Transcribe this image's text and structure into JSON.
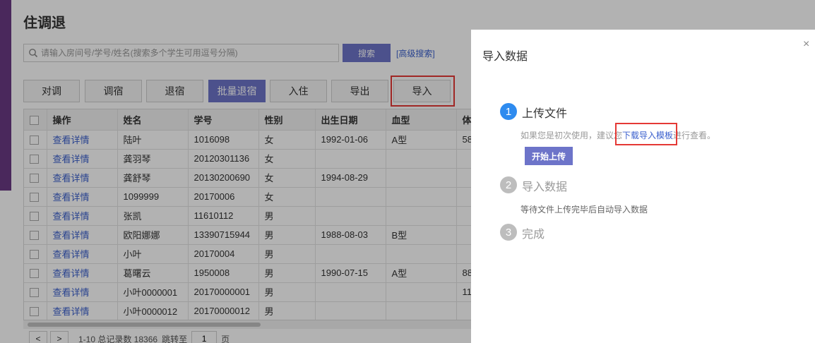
{
  "page": {
    "title": "住调退"
  },
  "search": {
    "placeholder": "请输入房间号/学号/姓名(搜索多个学生可用逗号分隔)",
    "button": "搜索",
    "advanced": "[高级搜索]"
  },
  "toolbar": {
    "buttons": [
      "对调",
      "调宿",
      "退宿",
      "批量退宿",
      "入住",
      "导出",
      "导入"
    ]
  },
  "table": {
    "columns": [
      "操作",
      "姓名",
      "学号",
      "性别",
      "出生日期",
      "血型",
      "体"
    ],
    "rows": [
      [
        "查看详情",
        "陆叶",
        "1016098",
        "女",
        "1992-01-06",
        "A型",
        "58"
      ],
      [
        "查看详情",
        "龚羽琴",
        "20120301136",
        "女",
        "",
        "",
        ""
      ],
      [
        "查看详情",
        "龚舒琴",
        "20130200690",
        "女",
        "1994-08-29",
        "",
        ""
      ],
      [
        "查看详情",
        "1099999",
        "20170006",
        "女",
        "",
        "",
        ""
      ],
      [
        "查看详情",
        "张凯",
        "11610112",
        "男",
        "",
        "",
        ""
      ],
      [
        "查看详情",
        "欧阳娜娜",
        "13390715944",
        "男",
        "1988-08-03",
        "B型",
        ""
      ],
      [
        "查看详情",
        "小叶",
        "20170004",
        "男",
        "",
        "",
        ""
      ],
      [
        "查看详情",
        "葛曙云",
        "1950008",
        "男",
        "1990-07-15",
        "A型",
        "88"
      ],
      [
        "查看详情",
        "小叶0000001",
        "20170000001",
        "男",
        "",
        "",
        "11"
      ],
      [
        "查看详情",
        "小叶0000012",
        "20170000012",
        "男",
        "",
        "",
        ""
      ]
    ]
  },
  "pager": {
    "prev": "<",
    "next": ">",
    "summary": "1-10 总记录数 18366",
    "jump_label": "跳转至",
    "page": "1",
    "page_unit": "页"
  },
  "dialog": {
    "title": "导入数据",
    "close": "×",
    "steps": [
      {
        "num": "1",
        "title": "上传文件",
        "desc_before": "如果您是初次使用，建议您",
        "desc_link": "下载导入模板",
        "desc_after": "进行查看。",
        "button": "开始上传"
      },
      {
        "num": "2",
        "title": "导入数据",
        "desc": "等待文件上传完毕后自动导入数据"
      },
      {
        "num": "3",
        "title": "完成"
      }
    ]
  },
  "colors": {
    "primary": "#6d74c9",
    "accent_blue": "#2e8bef",
    "link": "#3a5fcd",
    "highlight": "#e53935",
    "sidebar": "#6a3a85"
  }
}
